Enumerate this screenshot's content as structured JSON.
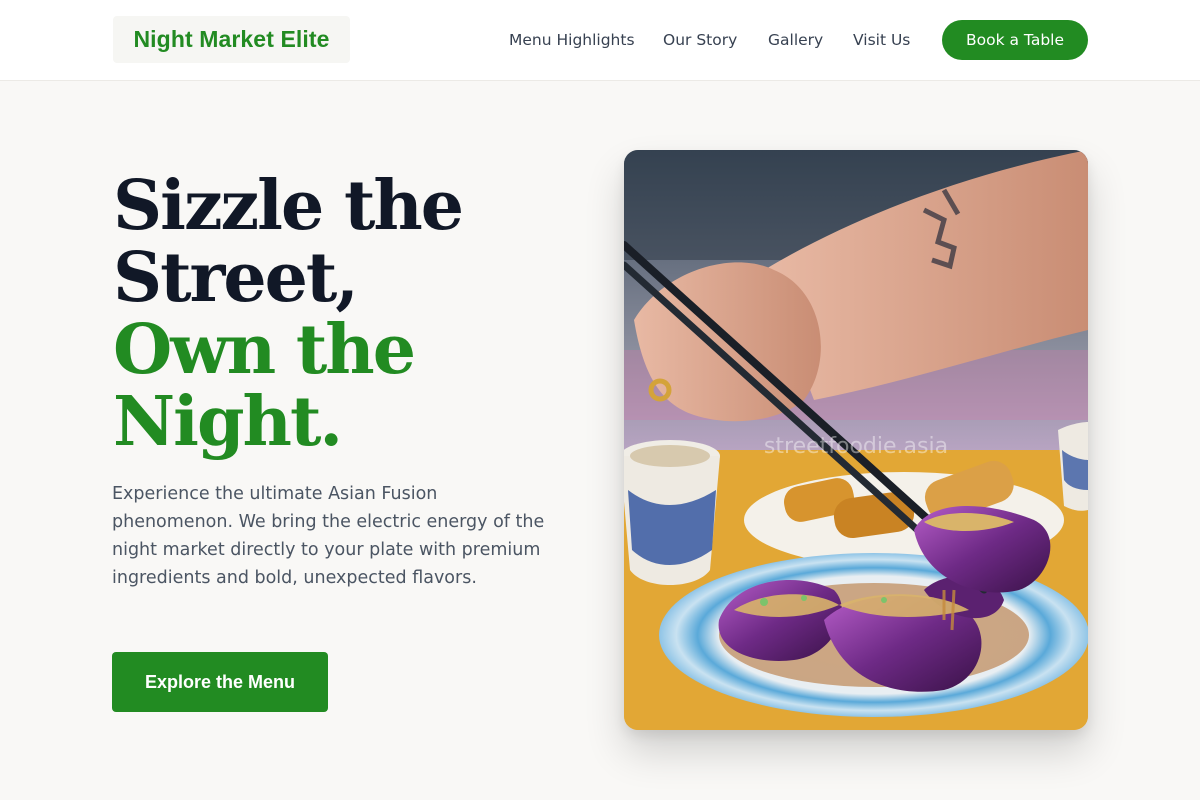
{
  "header": {
    "brand": "Night Market Elite",
    "nav": [
      {
        "label": "Menu Highlights"
      },
      {
        "label": "Our Story"
      },
      {
        "label": "Gallery"
      },
      {
        "label": "Visit Us"
      }
    ],
    "cta_label": "Book a Table"
  },
  "hero": {
    "headline": {
      "line1": "Sizzle the",
      "line2": "Street,",
      "line3": "Own the",
      "line4": "Night."
    },
    "description": "Experience the ultimate Asian Fusion phenomenon. We bring the electric energy of the night market directly to your plate with premium ingredients and bold, unexpected flavors.",
    "cta_label": "Explore the Menu"
  },
  "image": {
    "subject": "chopsticks lifting glazed eggplant over a blue-rimmed plate",
    "watermark": "streetfoodie.asia"
  },
  "colors": {
    "brand_green": "#228b22",
    "headline_dark": "#111827",
    "body_text": "#4b5563",
    "background": "#f9f8f6"
  }
}
